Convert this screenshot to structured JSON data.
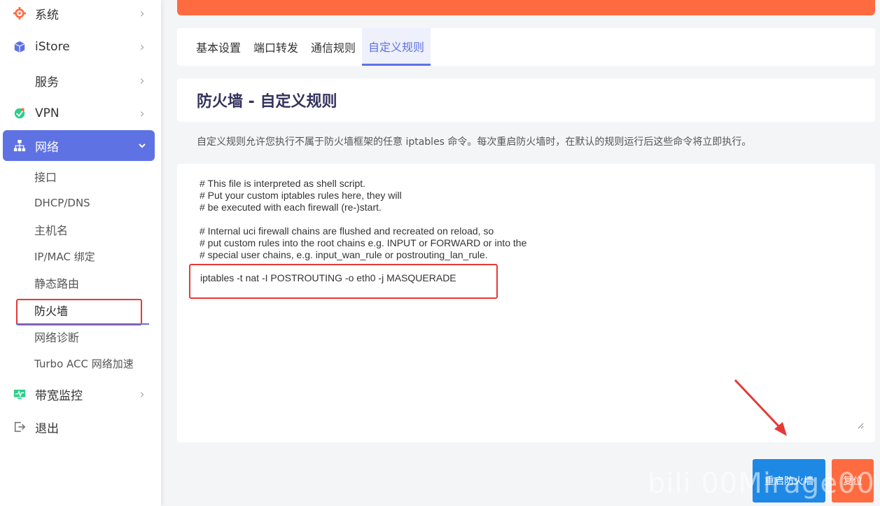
{
  "sidebar": {
    "items": [
      {
        "label": "系统",
        "icon": "gear-icon"
      },
      {
        "label": "iStore",
        "icon": "cube-icon"
      },
      {
        "label": "服务",
        "icon": ""
      },
      {
        "label": "VPN",
        "icon": "vpn-icon"
      },
      {
        "label": "网络",
        "icon": "network-icon"
      },
      {
        "label": "带宽监控",
        "icon": "monitor-icon"
      },
      {
        "label": "退出",
        "icon": "logout-icon"
      }
    ],
    "sub_items": [
      "接口",
      "DHCP/DNS",
      "主机名",
      "IP/MAC 绑定",
      "静态路由",
      "防火墙",
      "网络诊断",
      "Turbo ACC 网络加速"
    ]
  },
  "tabs": [
    "基本设置",
    "端口转发",
    "通信规则",
    "自定义规则"
  ],
  "page": {
    "title": "防火墙 - 自定义规则",
    "description": "自定义规则允许您执行不属于防火墙框架的任意 iptables 命令。每次重启防火墙时，在默认的规则运行后这些命令将立即执行。"
  },
  "editor": {
    "comments": "# This file is interpreted as shell script.\n# Put your custom iptables rules here, they will\n# be executed with each firewall (re-)start.\n\n# Internal uci firewall chains are flushed and recreated on reload, so\n# put custom rules into the root chains e.g. INPUT or FORWARD or into the\n# special user chains, e.g. input_wan_rule or postrouting_lan_rule.",
    "command": "iptables -t nat -I POSTROUTING -o eth0 -j MASQUERADE"
  },
  "buttons": {
    "restart": "重启防火墙",
    "reset": "复位"
  },
  "watermark": "bili 00Mirage00",
  "colors": {
    "accent": "#5e72e4",
    "topbar": "#ff6b40",
    "highlight": "#e53935",
    "restart": "#1e88e5"
  }
}
